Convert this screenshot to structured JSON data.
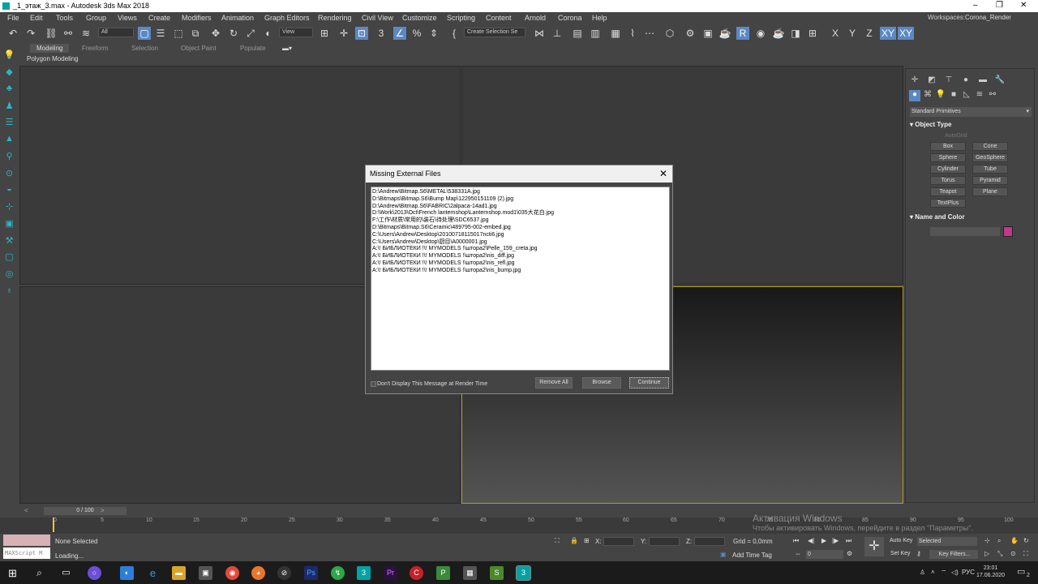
{
  "titlebar": {
    "title": "_1_этаж_3.max - Autodesk 3ds Max 2018",
    "min": "–",
    "restore": "❐",
    "close": "✕"
  },
  "menu": {
    "items": [
      "File",
      "Edit",
      "Tools",
      "Group",
      "Views",
      "Create",
      "Modifiers",
      "Animation",
      "Graph Editors",
      "Rendering",
      "Civil View",
      "Customize",
      "Scripting",
      "Content",
      "Arnold",
      "Corona",
      "Help"
    ],
    "workspaces_label": "Workspaces:",
    "workspace_value": "Corona_Render"
  },
  "toolbar": {
    "filter_value": "All",
    "refcoord_value": "View",
    "selection_set_placeholder": "Create Selection Se",
    "xyz": [
      "X",
      "Y",
      "Z",
      "XY",
      "XY"
    ]
  },
  "ribbon": {
    "tabs": [
      "Modeling",
      "Freeform",
      "Selection",
      "Object Paint",
      "Populate"
    ],
    "active": "Modeling",
    "panel_label": "Polygon Modeling"
  },
  "command_panel": {
    "category": "Standard Primitives",
    "object_type_title": "Object Type",
    "autogrid": "AutoGrid",
    "primitives": [
      "Box",
      "Cone",
      "Sphere",
      "GeoSphere",
      "Cylinder",
      "Tube",
      "Torus",
      "Pyramid",
      "Teapot",
      "Plane",
      "TextPlus"
    ],
    "name_color_title": "Name and Color",
    "color": "#c2388a"
  },
  "dialog": {
    "title": "Missing External Files",
    "close": "✕",
    "files": [
      "D:\\Andrew\\Bitmap.S6\\METAL\\538331A.jpg",
      "D:\\Bitmaps\\Bitmap.S6\\Bump Map\\122950151109 (2).jpg",
      "D:\\Andrew\\Bitmap.S6\\FABRIC\\2alpaca-14ad1.jpg",
      "D:\\Work\\2013\\Oct\\French lanternshop\\Lanternshop.mod1\\035大花白.jpg",
      "F:\\工作\\材质\\常用的\\装石\\待处理\\SDC6537.jpg",
      "D:\\Bitmaps\\Bitmap.S6\\Ceramic\\489795-002-embed.jpg",
      "C:\\Users\\Andrew\\Desktop\\20100718115017ncti6.jpg",
      "C:\\Users\\Andrew\\Desktop\\厨目\\A0000001.jpg",
      "A:\\! БИБЛИОТЕКИ !\\! MYMODELS !\\штора2\\Pelle_159_creta.jpg",
      "A:\\! БИБЛИОТЕКИ !\\! MYMODELS !\\штора2\\nis_diff.jpg",
      "A:\\! БИБЛИОТЕКИ !\\! MYMODELS !\\штора2\\nis_refl.jpg",
      "A:\\! БИБЛИОТЕКИ !\\! MYMODELS !\\штора2\\nis_bump.jpg"
    ],
    "checkbox_label": "Don't Display This Message at Render Time",
    "buttons": {
      "remove_all": "Remove All",
      "browse": "Browse",
      "continue": "Continue"
    }
  },
  "timeline": {
    "slider": "0 / 100",
    "ticks": [
      "0",
      "5",
      "10",
      "15",
      "20",
      "25",
      "30",
      "35",
      "40",
      "45",
      "50",
      "55",
      "60",
      "65",
      "70",
      "75",
      "80",
      "85",
      "90",
      "95",
      "100"
    ]
  },
  "status": {
    "maxscript": "MAXScript M",
    "selection": "None Selected",
    "loading": "Loading...",
    "x_label": "X:",
    "y_label": "Y:",
    "z_label": "Z:",
    "grid": "Grid = 0,0mm",
    "add_time_tag": "Add Time Tag",
    "auto_key": "Auto Key",
    "set_key": "Set Key",
    "selected": "Selected",
    "key_filters": "Key Filters...",
    "frame": "0"
  },
  "watermark": {
    "line1": "Активация Windows",
    "line2": "Чтобы активировать Windows, перейдите в раздел \"Параметры\"."
  },
  "taskbar": {
    "lang": "РУС",
    "time": "23:01",
    "date": "17.06.2020",
    "notif_count": "2"
  }
}
